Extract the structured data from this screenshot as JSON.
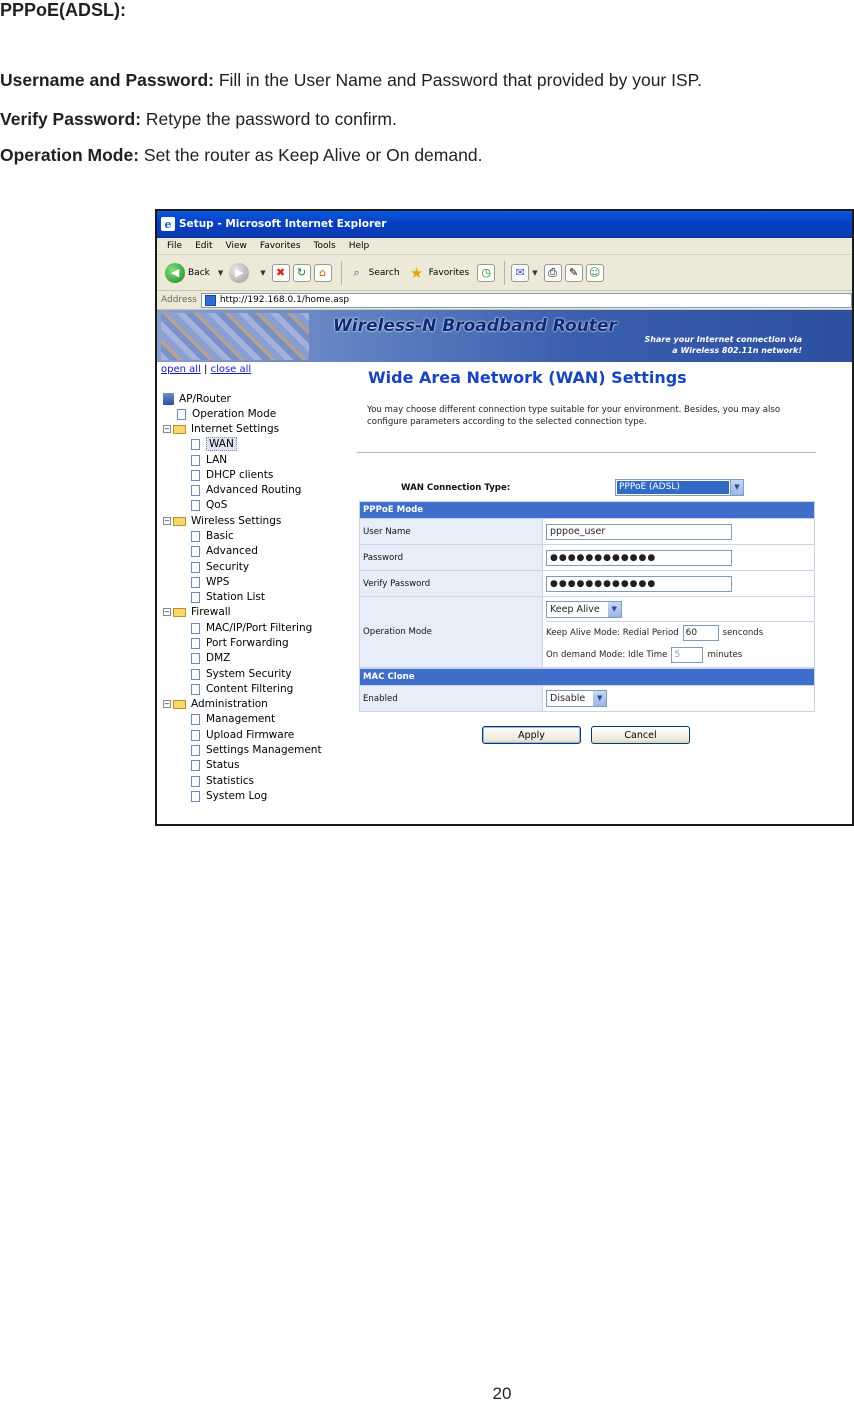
{
  "doc": {
    "heading": "PPPoE(ADSL):",
    "paragraphs": [
      {
        "term": "Username and Password:",
        "text": " Fill in the User Name and Password that provided by your ISP."
      },
      {
        "term": "Verify Password:",
        "text": " Retype the password to confirm."
      },
      {
        "term": "Operation Mode:",
        "text": " Set the router as Keep Alive or On demand."
      }
    ],
    "page_number": "20"
  },
  "browser": {
    "window_title": "Setup - Microsoft Internet Explorer",
    "menu": [
      "File",
      "Edit",
      "View",
      "Favorites",
      "Tools",
      "Help"
    ],
    "toolbar": {
      "back": "Back",
      "search": "Search",
      "favorites": "Favorites"
    },
    "address_label": "Address",
    "address_url": "http://192.168.0.1/home.asp"
  },
  "router": {
    "banner_title": "Wireless-N Broadband Router",
    "banner_tagline_1": "Share your Internet connection via",
    "banner_tagline_2": "a Wireless 802.11n network!",
    "nav_links": {
      "open_all": "open all",
      "separator": "|",
      "close_all": "close all"
    },
    "tree": {
      "root": "AP/Router",
      "operation_mode": "Operation Mode",
      "internet_settings": "Internet Settings",
      "internet_children": [
        "WAN",
        "LAN",
        "DHCP clients",
        "Advanced Routing",
        "QoS"
      ],
      "wireless_settings": "Wireless Settings",
      "wireless_children": [
        "Basic",
        "Advanced",
        "Security",
        "WPS",
        "Station List"
      ],
      "firewall": "Firewall",
      "firewall_children": [
        "MAC/IP/Port Filtering",
        "Port Forwarding",
        "DMZ",
        "System Security",
        "Content Filtering"
      ],
      "administration": "Administration",
      "admin_children": [
        "Management",
        "Upload Firmware",
        "Settings Management",
        "Status",
        "Statistics",
        "System Log"
      ]
    },
    "main": {
      "title": "Wide Area Network (WAN) Settings",
      "description": "You may choose different connection type suitable for your environment. Besides, you may also configure parameters according to the selected connection type.",
      "connection_type_label": "WAN Connection Type:",
      "connection_type_value": "PPPoE (ADSL)",
      "pppoe_header": "PPPoE Mode",
      "username_label": "User Name",
      "username_value": "pppoe_user",
      "password_label": "Password",
      "password_value": "●●●●●●●●●●●●",
      "verify_label": "Verify Password",
      "verify_value": "●●●●●●●●●●●●",
      "opmode_label": "Operation Mode",
      "opmode_value": "Keep Alive",
      "keepalive_label": "Keep Alive Mode: Redial Period",
      "keepalive_value": "60",
      "keepalive_unit": "senconds",
      "ondemand_label": "On demand Mode: Idle Time",
      "ondemand_value": "5",
      "ondemand_unit": "minutes",
      "mac_header": "MAC Clone",
      "enabled_label": "Enabled",
      "enabled_value": "Disable",
      "apply_label": "Apply",
      "cancel_label": "Cancel"
    }
  }
}
